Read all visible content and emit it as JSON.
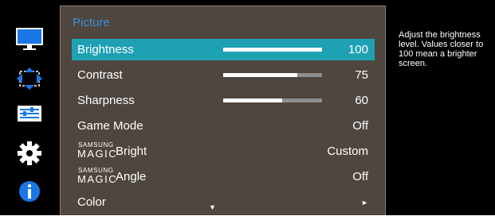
{
  "menu": {
    "title": "Picture",
    "items": [
      {
        "label": "Brightness",
        "value": "100",
        "level": 100,
        "selected": true
      },
      {
        "label": "Contrast",
        "value": "75",
        "level": 75
      },
      {
        "label": "Sharpness",
        "value": "60",
        "level": 60
      },
      {
        "label": "Game Mode",
        "value": "Off"
      },
      {
        "label_prefix_small": "SAMSUNG",
        "label_prefix_big": "MAGIC",
        "label": "Bright",
        "value": "Custom"
      },
      {
        "label_prefix_small": "SAMSUNG",
        "label_prefix_big": "MAGIC",
        "label": "Angle",
        "value": "Off"
      },
      {
        "label": "Color",
        "value": "►"
      }
    ],
    "scroll_indicator": "▼"
  },
  "help": {
    "text": "Adjust the brightness\nlevel. Values closer to\n100 mean a brighter\nscreen."
  },
  "sidebar": {
    "icons": [
      "monitor-icon",
      "screen-resize-icon",
      "sliders-icon",
      "gear-icon",
      "info-icon"
    ]
  },
  "colors": {
    "selected_row": "#1fa1b4",
    "menu_background": "#4e463f",
    "title": "#3d8fd6",
    "accent_icon": "#1977e6"
  }
}
